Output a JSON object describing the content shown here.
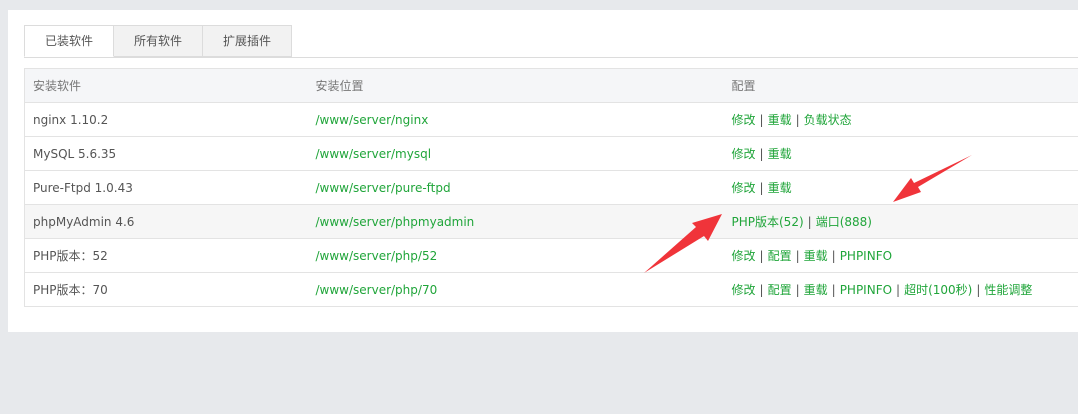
{
  "tabs": [
    {
      "label": "已装软件",
      "active": true
    },
    {
      "label": "所有软件",
      "active": false
    },
    {
      "label": "扩展插件",
      "active": false
    }
  ],
  "table": {
    "headers": [
      "安装软件",
      "安装位置",
      "配置"
    ],
    "rows": [
      {
        "name": "nginx 1.10.2",
        "path": "/www/server/nginx",
        "actions": [
          "修改",
          "重载",
          "负载状态"
        ]
      },
      {
        "name": "MySQL 5.6.35",
        "path": "/www/server/mysql",
        "actions": [
          "修改",
          "重载"
        ]
      },
      {
        "name": "Pure-Ftpd 1.0.43",
        "path": "/www/server/pure-ftpd",
        "actions": [
          "修改",
          "重载"
        ]
      },
      {
        "name": "phpMyAdmin 4.6",
        "path": "/www/server/phpmyadmin",
        "actions": [
          "PHP版本(52)",
          "端口(888)"
        ]
      },
      {
        "name": "PHP版本：52",
        "path": "/www/server/php/52",
        "actions": [
          "修改",
          "配置",
          "重载",
          "PHPINFO"
        ]
      },
      {
        "name": "PHP版本：70",
        "path": "/www/server/php/70",
        "actions": [
          "修改",
          "配置",
          "重载",
          "PHPINFO",
          "超时(100秒)",
          "性能调整"
        ]
      }
    ],
    "separator": "|"
  },
  "colors": {
    "link": "#20a53a",
    "arrow": "#f0343a",
    "background": "#e7e9ec"
  }
}
